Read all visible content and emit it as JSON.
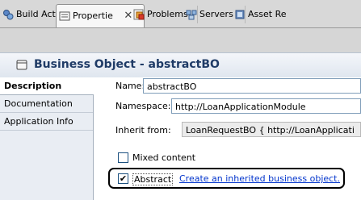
{
  "tabs": [
    {
      "label": "Build Acti",
      "icon": "build-activities-icon"
    },
    {
      "label": "Propertie",
      "icon": "properties-icon",
      "active": true,
      "close": "✕"
    },
    {
      "label": "Problems",
      "icon": "problems-icon"
    },
    {
      "label": "Servers",
      "icon": "servers-icon"
    },
    {
      "label": "Asset Re",
      "icon": "asset-repository-icon"
    }
  ],
  "header": {
    "title": "Business Object - abstractBO",
    "icon": "business-object-icon"
  },
  "nav": {
    "items": [
      {
        "label": "Description",
        "selected": true
      },
      {
        "label": "Documentation"
      },
      {
        "label": "Application Info"
      }
    ]
  },
  "form": {
    "name_label": "Name:",
    "name_value": "abstractBO",
    "namespace_label": "Namespace:",
    "namespace_value": "http://LoanApplicationModule",
    "inherit_label": "Inherit from:",
    "inherit_value": "LoanRequestBO   { http://LoanApplicati",
    "mixed_label": "Mixed content",
    "mixed_checked": false,
    "abstract_label": "Abstract",
    "abstract_checked": true,
    "abstract_check_glyph": "✔",
    "link_text": "Create an inherited business object."
  },
  "colors": {
    "title": "#1f3b66",
    "link": "#0033cc",
    "nav_bg": "#e9edf3"
  }
}
